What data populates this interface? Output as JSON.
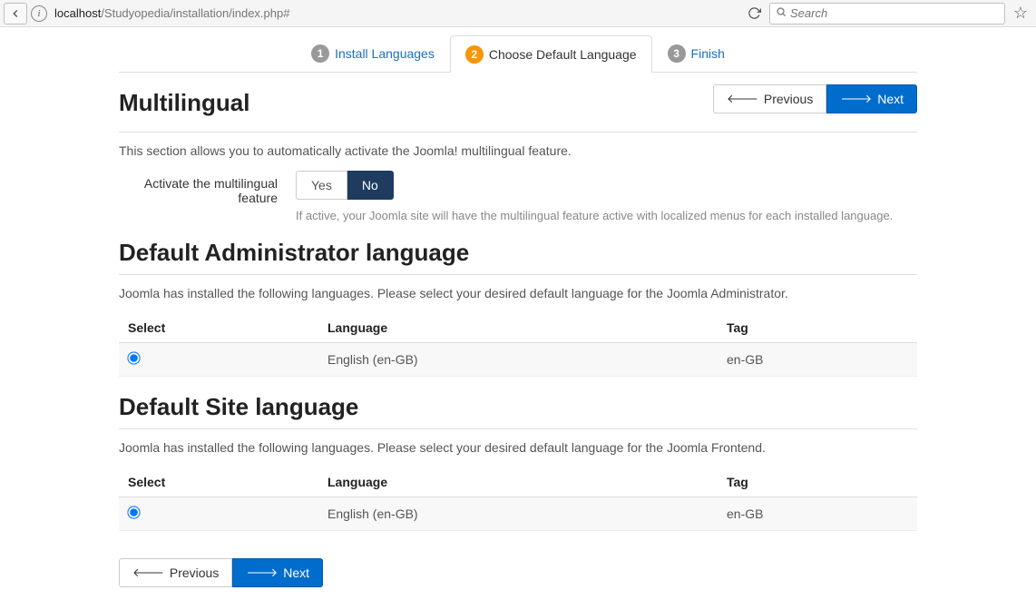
{
  "browser": {
    "url_host": "localhost",
    "url_path": "/Studyopedia/installation/index.php#",
    "search_placeholder": "Search"
  },
  "wizard": {
    "tabs": [
      {
        "num": "1",
        "label": "Install Languages"
      },
      {
        "num": "2",
        "label": "Choose Default Language"
      },
      {
        "num": "3",
        "label": "Finish"
      }
    ]
  },
  "buttons": {
    "previous": "Previous",
    "next": "Next"
  },
  "multilingual": {
    "title": "Multilingual",
    "desc": "This section allows you to automatically activate the Joomla! multilingual feature.",
    "label": "Activate the multilingual feature",
    "yes": "Yes",
    "no": "No",
    "help": "If active, your Joomla site will have the multilingual feature active with localized menus for each installed language."
  },
  "admin": {
    "title": "Default Administrator language",
    "desc": "Joomla has installed the following languages. Please select your desired default language for the Joomla Administrator.",
    "headers": {
      "select": "Select",
      "language": "Language",
      "tag": "Tag"
    },
    "rows": [
      {
        "language": "English (en-GB)",
        "tag": "en-GB"
      }
    ]
  },
  "site": {
    "title": "Default Site language",
    "desc": "Joomla has installed the following languages. Please select your desired default language for the Joomla Frontend.",
    "headers": {
      "select": "Select",
      "language": "Language",
      "tag": "Tag"
    },
    "rows": [
      {
        "language": "English (en-GB)",
        "tag": "en-GB"
      }
    ]
  }
}
